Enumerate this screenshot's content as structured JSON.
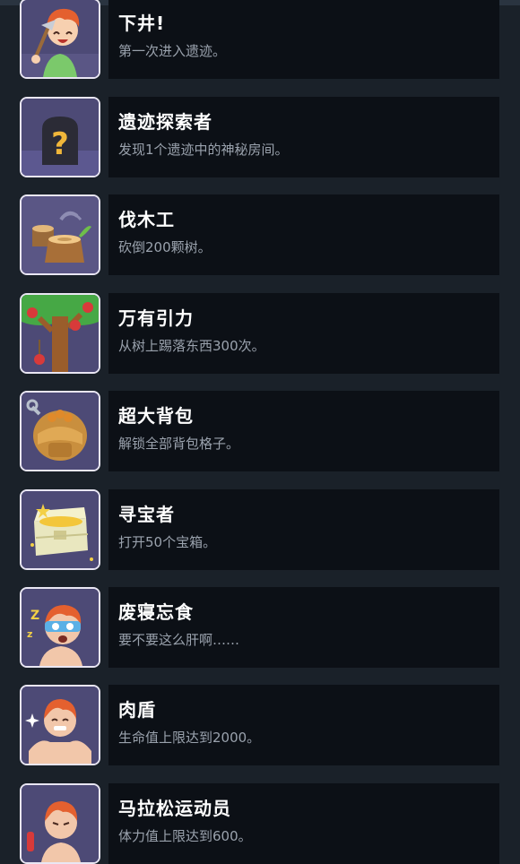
{
  "achievements": [
    {
      "title": "下井!",
      "description": "第一次进入遗迹。",
      "icon": "miner-boy-icon"
    },
    {
      "title": "遗迹探索者",
      "description": "发现1个遗迹中的神秘房间。",
      "icon": "mystery-door-icon"
    },
    {
      "title": "伐木工",
      "description": "砍倒200颗树。",
      "icon": "tree-stump-icon"
    },
    {
      "title": "万有引力",
      "description": "从树上踢落东西300次。",
      "icon": "apple-tree-icon"
    },
    {
      "title": "超大背包",
      "description": "解锁全部背包格子。",
      "icon": "backpack-icon"
    },
    {
      "title": "寻宝者",
      "description": "打开50个宝箱。",
      "icon": "treasure-chest-icon"
    },
    {
      "title": "废寝忘食",
      "description": "要不要这么肝啊……",
      "icon": "sleepless-boy-icon"
    },
    {
      "title": "肉盾",
      "description": "生命值上限达到2000。",
      "icon": "muscle-boy-icon"
    },
    {
      "title": "马拉松运动员",
      "description": "体力值上限达到600。",
      "icon": "runner-boy-icon"
    }
  ],
  "colors": {
    "background": "#1a2129",
    "card": "#0c1016",
    "title": "#ffffff",
    "description": "#9aa2ad",
    "icon_bg": "#4d4a76"
  }
}
